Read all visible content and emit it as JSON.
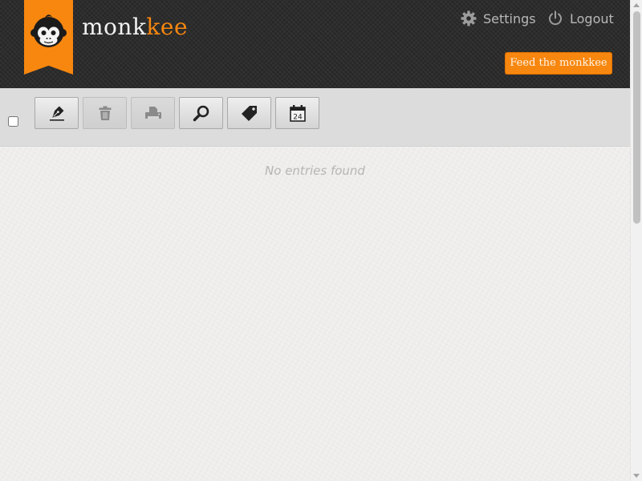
{
  "brand": {
    "name_part1": "monk",
    "name_part2": "kee",
    "accent_color": "#f7870f",
    "logo_icon": "monkey-face-icon"
  },
  "nav": {
    "settings_label": "Settings",
    "settings_icon": "gear-icon",
    "logout_label": "Logout",
    "logout_icon": "power-icon"
  },
  "feed_button_label": "Feed the monkkee",
  "toolbar": {
    "select_all_checked": false,
    "buttons": [
      {
        "name": "new-entry",
        "icon": "pen-nib-icon",
        "enabled": true
      },
      {
        "name": "delete",
        "icon": "trash-icon",
        "enabled": false
      },
      {
        "name": "print",
        "icon": "printer-icon",
        "enabled": false
      },
      {
        "name": "search",
        "icon": "magnifier-icon",
        "enabled": true
      },
      {
        "name": "tags",
        "icon": "tag-icon",
        "enabled": true
      },
      {
        "name": "calendar",
        "icon": "calendar-icon",
        "enabled": true,
        "calendar_day": "24"
      }
    ]
  },
  "content": {
    "empty_message": "No entries found"
  }
}
